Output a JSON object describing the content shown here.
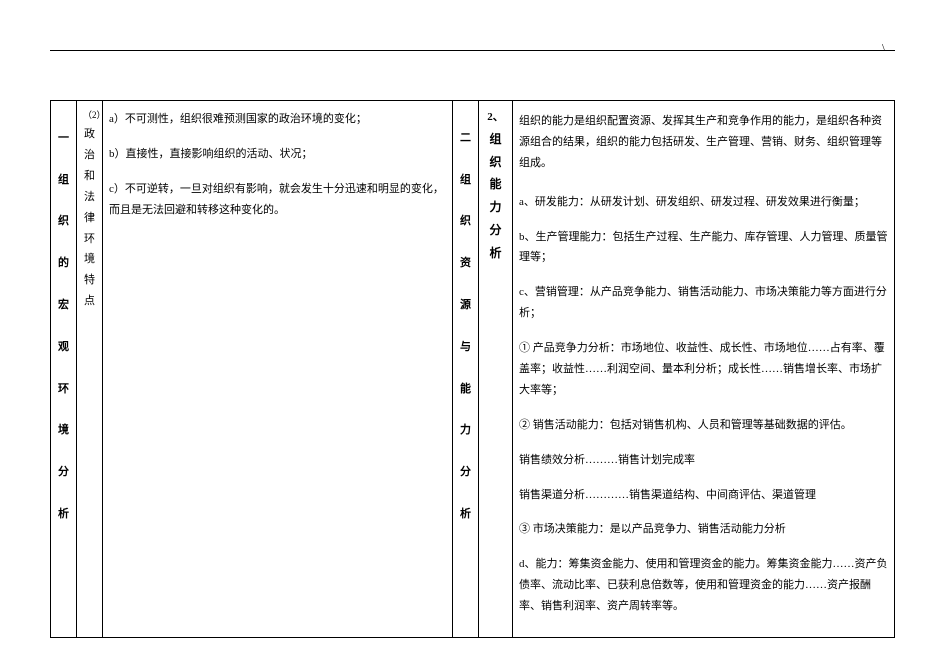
{
  "header": {
    "topMark": "\\"
  },
  "left": {
    "sectionNumber": "一",
    "sectionTitle": "组织的宏观环境分析",
    "subNumber": "（2）",
    "subTitle": "政治和法律环境特点",
    "items": {
      "a": "a）不可测性，组织很难预测国家的政治环境的变化；",
      "b": "b）直接性，直接影响组织的活动、状况；",
      "c": "c）不可逆转，一旦对组织有影响，就会发生十分迅速和明显的变化，而且是无法回避和转移这种变化的。"
    }
  },
  "right": {
    "sectionNumber": "二",
    "sectionTitle": "组织资源与能力分析",
    "subNumber": "2、",
    "subTitle": "组织能力分析",
    "intro": "组织的能力是组织配置资源、发挥其生产和竞争作用的能力，是组织各种资源组合的结果，组织的能力包括研发、生产管理、营销、财务、组织管理等组成。",
    "pA": "a、研发能力：从研发计划、研发组织、研发过程、研发效果进行衡量；",
    "pB": "b、生产管理能力：包括生产过程、生产能力、库存管理、人力管理、质量管理等；",
    "pC": "c、营销管理：从产品竞争能力、销售活动能力、市场决策能力等方面进行分析；",
    "p1": "① 产品竞争力分析：市场地位、收益性、成长性、市场地位……占有率、覆盖率；收益性……利润空间、量本利分析；成长性……销售增长率、市场扩大率等；",
    "p2": "② 销售活动能力：包括对销售机构、人员和管理等基础数据的评估。",
    "pSaleEff": "销售绩效分析………销售计划完成率",
    "pSaleChannel": "销售渠道分析…………销售渠道结构、中间商评估、渠道管理",
    "p3": "③ 市场决策能力：是以产品竞争力、销售活动能力分析",
    "pD": "d、能力：筹集资金能力、使用和管理资金的能力。筹集资金能力……资产负债率、流动比率、已获利息倍数等，使用和管理资金的能力……资产报酬率、销售利润率、资产周转率等。"
  }
}
